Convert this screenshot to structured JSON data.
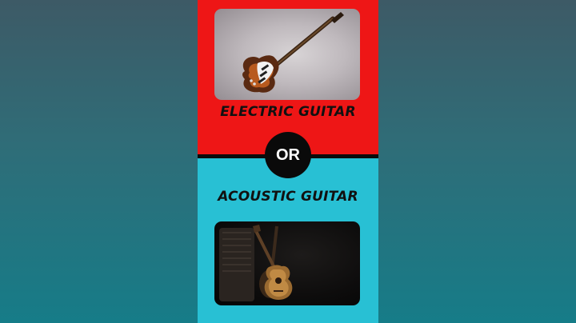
{
  "options": {
    "electric": {
      "label": "ELECTRIC GUITAR",
      "icon": "electric-guitar-icon"
    },
    "acoustic": {
      "label": "ACOUSTIC GUITAR",
      "icon": "acoustic-guitar-icon"
    }
  },
  "versus_label": "OR",
  "colors": {
    "top_panel": "#ee1616",
    "bottom_panel": "#28c0d4",
    "badge": "#0a0a0a",
    "background": "#2f6d78"
  }
}
